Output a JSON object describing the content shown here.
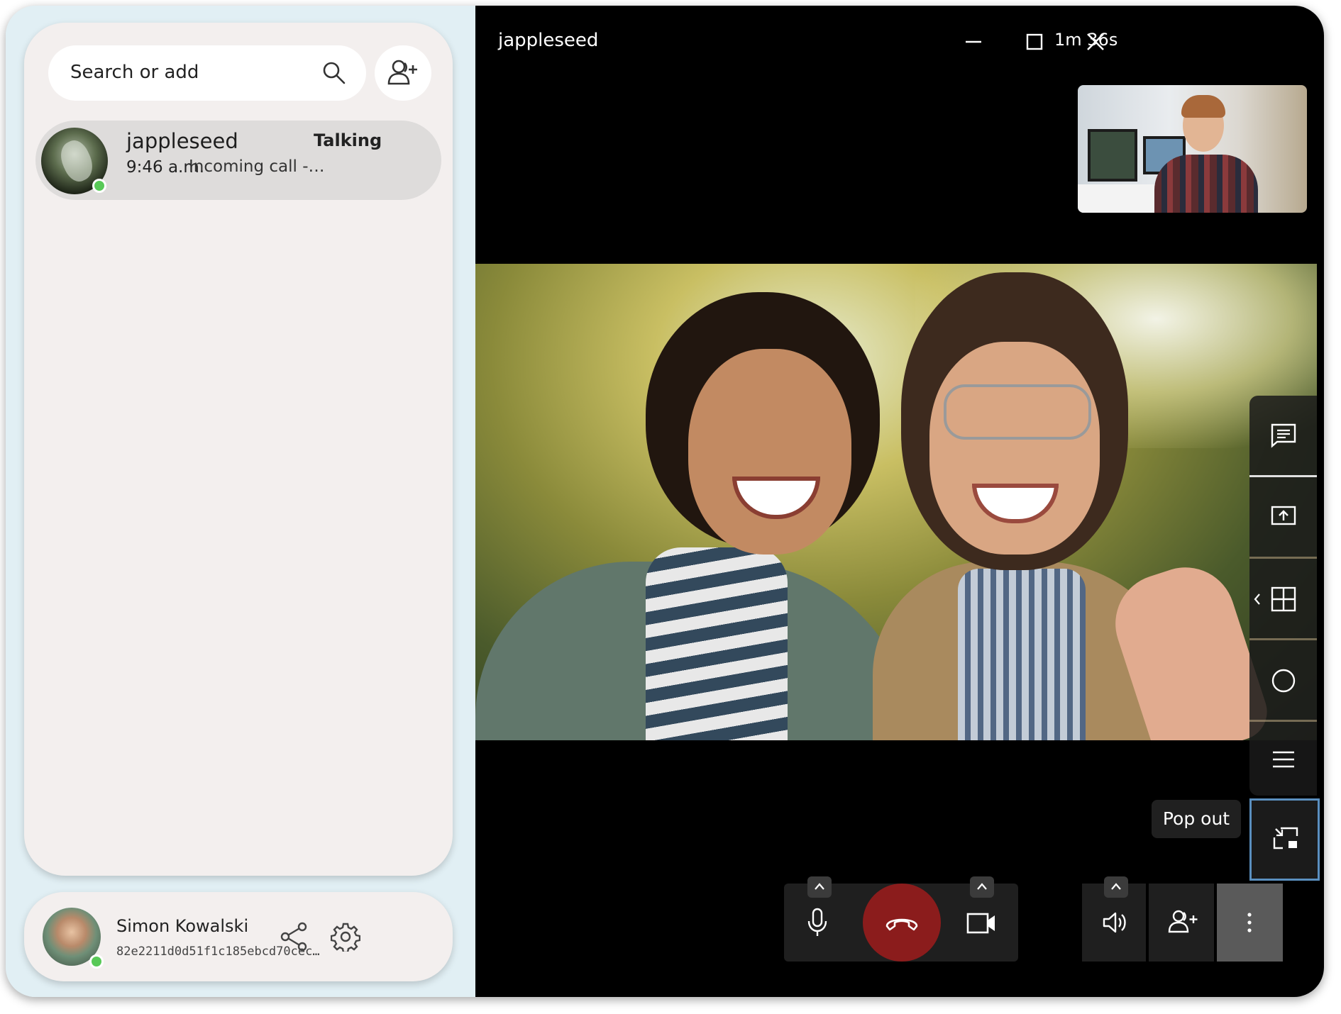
{
  "sidebar": {
    "search": {
      "placeholder": "Search or add"
    },
    "conversations": [
      {
        "name": "jappleseed",
        "status": "Talking",
        "time": "9:46 a.m.",
        "preview": "Incoming call -…",
        "online": true
      }
    ],
    "account": {
      "name": "Simon Kowalski",
      "id": "82e2211d0d51f1c185ebcd70cec…",
      "online": true
    }
  },
  "call": {
    "title": "jappleseed",
    "duration": "1m 36s",
    "tooltip": "Pop out"
  },
  "icons": {
    "search": "search-icon",
    "add_contact": "person-add-icon",
    "share": "share-icon",
    "settings": "gear-icon",
    "minimize": "minimize-icon",
    "maximize": "maximize-icon",
    "close": "close-icon",
    "chat": "chat-icon",
    "screen_share": "screen-share-icon",
    "layout": "grid-layout-icon",
    "record": "record-icon",
    "menu": "menu-icon",
    "pop_out": "pop-out-icon",
    "mic": "microphone-icon",
    "hang_up": "hang-up-icon",
    "camera": "video-camera-icon",
    "speaker": "speaker-icon",
    "more": "more-vertical-icon"
  },
  "colors": {
    "accent_online": "#58c957",
    "hangup": "#8b1c1c",
    "popout_border": "#5a8fbf"
  }
}
